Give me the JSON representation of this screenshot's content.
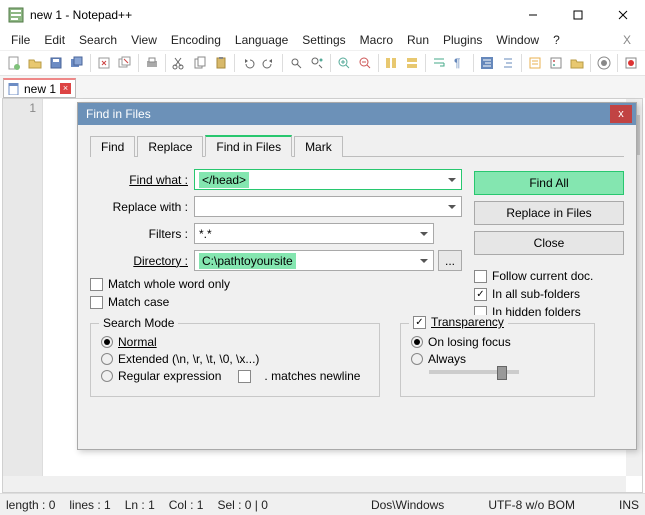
{
  "title": "new  1 - Notepad++",
  "menu": [
    "File",
    "Edit",
    "Search",
    "View",
    "Encoding",
    "Language",
    "Settings",
    "Macro",
    "Run",
    "Plugins",
    "Window",
    "?"
  ],
  "tab": {
    "name": "new  1"
  },
  "gutter_line": "1",
  "dialog": {
    "title": "Find in Files",
    "tabs": [
      "Find",
      "Replace",
      "Find in Files",
      "Mark"
    ],
    "find_label": "Find what :",
    "find_value": "</head>",
    "replace_label": "Replace with :",
    "replace_value": "",
    "filters_label": "Filters :",
    "filters_value": "*.*",
    "directory_label": "Directory :",
    "directory_value": "C:\\pathtoyoursite",
    "browse_label": "...",
    "btn_findall": "Find All",
    "btn_replaceinfiles": "Replace in Files",
    "btn_close": "Close",
    "chk_follow": "Follow current doc.",
    "chk_subfolders": "In all sub-folders",
    "chk_hidden": "In hidden folders",
    "chk_wholeword": "Match whole word only",
    "chk_matchcase": "Match case",
    "group_searchmode": "Search Mode",
    "radio_normal": "Normal",
    "radio_extended": "Extended (\\n, \\r, \\t, \\0, \\x...)",
    "radio_regex": "Regular expression",
    "chk_newline": ". matches newline",
    "chk_transparency": "Transparency",
    "radio_onlosing": "On losing focus",
    "radio_always": "Always"
  },
  "status": {
    "length": "length : 0",
    "lines": "lines : 1",
    "ln": "Ln : 1",
    "col": "Col : 1",
    "sel": "Sel : 0 | 0",
    "eol": "Dos\\Windows",
    "enc": "UTF-8 w/o BOM",
    "mode": "INS"
  }
}
